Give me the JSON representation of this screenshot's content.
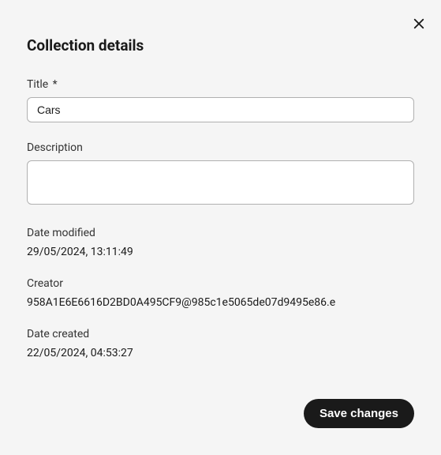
{
  "heading": "Collection details",
  "fields": {
    "title": {
      "label": "Title",
      "required_mark": "*",
      "value": "Cars"
    },
    "description": {
      "label": "Description",
      "value": ""
    }
  },
  "meta": {
    "date_modified": {
      "label": "Date modified",
      "value": "29/05/2024, 13:11:49"
    },
    "creator": {
      "label": "Creator",
      "value": "958A1E6E6616D2BD0A495CF9@985c1e5065de07d9495e86.e"
    },
    "date_created": {
      "label": "Date created",
      "value": "22/05/2024, 04:53:27"
    }
  },
  "buttons": {
    "save": "Save changes"
  }
}
